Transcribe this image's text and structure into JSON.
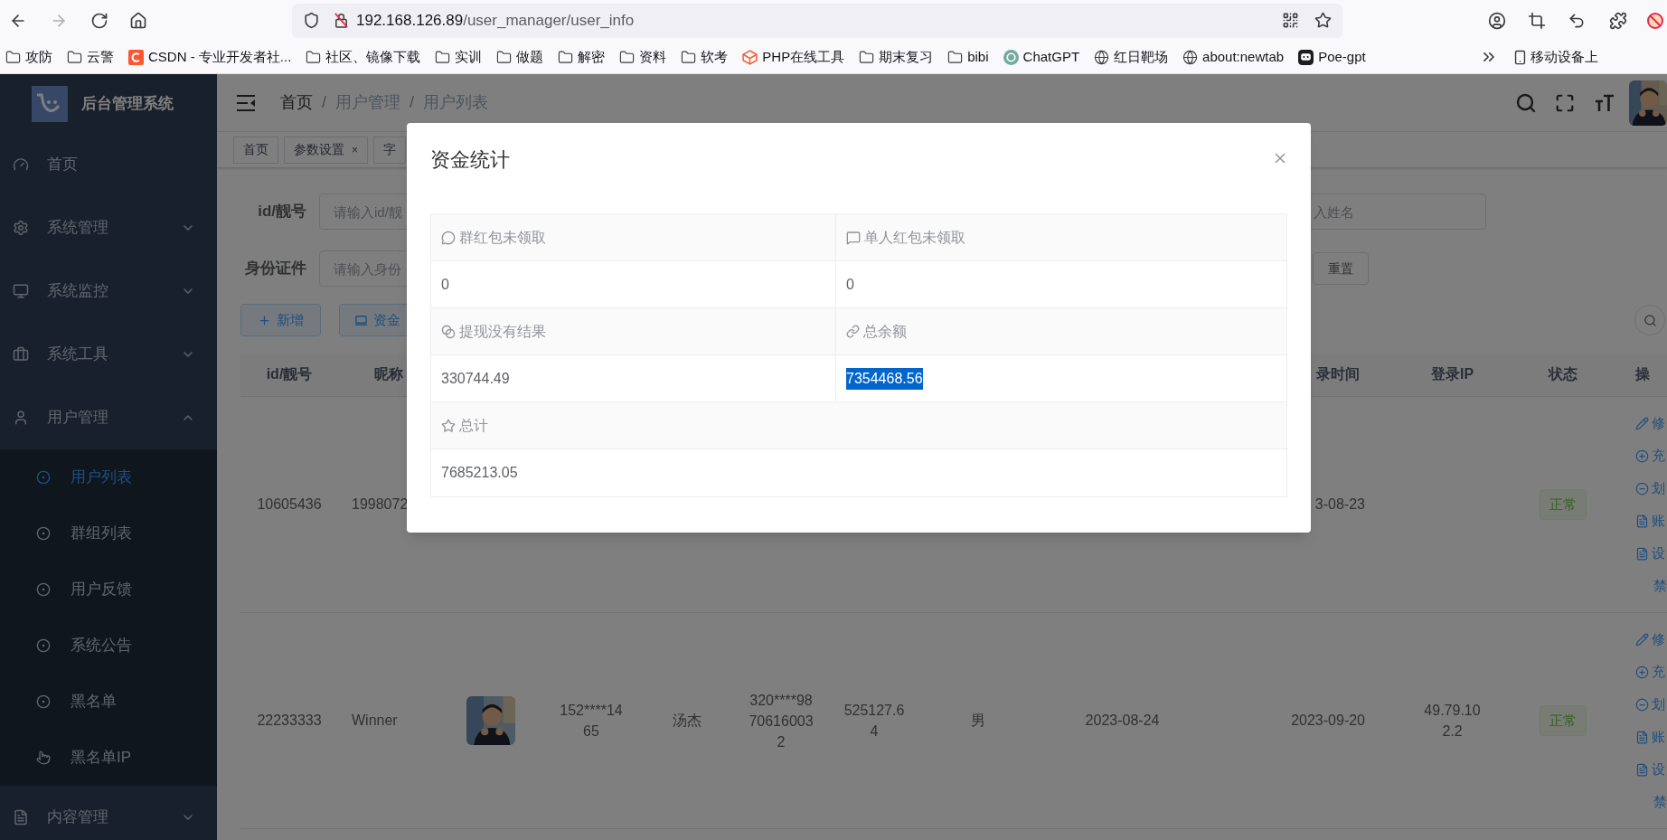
{
  "browser": {
    "url_host": "192.168.126.89",
    "url_path": "/user_manager/user_info",
    "bookmarks": [
      {
        "label": "攻防",
        "kind": "folder"
      },
      {
        "label": "云警",
        "kind": "folder"
      },
      {
        "label": "CSDN - 专业开发者社...",
        "kind": "csdn"
      },
      {
        "label": "社区、镜像下载",
        "kind": "folder"
      },
      {
        "label": "实训",
        "kind": "folder"
      },
      {
        "label": "做题",
        "kind": "folder"
      },
      {
        "label": "解密",
        "kind": "folder"
      },
      {
        "label": "资料",
        "kind": "folder"
      },
      {
        "label": "软考",
        "kind": "folder"
      },
      {
        "label": "PHP在线工具",
        "kind": "php"
      },
      {
        "label": "期末复习",
        "kind": "folder"
      },
      {
        "label": "bibi",
        "kind": "folder"
      },
      {
        "label": "ChatGPT",
        "kind": "chatgpt"
      },
      {
        "label": "红日靶场",
        "kind": "globe"
      },
      {
        "label": "about:newtab",
        "kind": "globe"
      },
      {
        "label": "Poe-gpt",
        "kind": "poe"
      }
    ],
    "mobile_bookmarks": "移动设备上"
  },
  "sidebar": {
    "title": "后台管理系统",
    "items": [
      {
        "label": "首页"
      },
      {
        "label": "系统管理",
        "expanded": false
      },
      {
        "label": "系统监控",
        "expanded": false
      },
      {
        "label": "系统工具",
        "expanded": false
      },
      {
        "label": "用户管理",
        "expanded": true,
        "children": [
          {
            "label": "用户列表",
            "selected": true
          },
          {
            "label": "群组列表",
            "selected": false
          },
          {
            "label": "用户反馈",
            "selected": false
          },
          {
            "label": "系统公告",
            "selected": false
          },
          {
            "label": "黑名单",
            "selected": false
          },
          {
            "label": "黑名单IP",
            "selected": false
          }
        ]
      },
      {
        "label": "内容管理",
        "expanded": false
      }
    ]
  },
  "header": {
    "breadcrumbs": [
      {
        "label": "首页",
        "link": true
      },
      {
        "label": "用户管理",
        "link": false
      },
      {
        "label": "用户列表",
        "link": false
      }
    ],
    "separators": [
      "/",
      "/"
    ]
  },
  "tags": [
    {
      "label": "首页"
    },
    {
      "label": "参数设置",
      "close_mark": "×"
    },
    {
      "label": "字"
    }
  ],
  "search_form": {
    "fields": [
      {
        "label": "id/靓号",
        "placeholder": "请输入id/靓"
      },
      {
        "placeholder": "入姓名"
      },
      {
        "label": "身份证件",
        "placeholder": "请输入身份"
      }
    ],
    "reset_button": "重置"
  },
  "toolbar": {
    "buttons": [
      {
        "label": "新增",
        "kind": "add"
      },
      {
        "label": "资金",
        "kind": "stats"
      }
    ]
  },
  "table": {
    "columns": [
      {
        "label": "id/靓号"
      },
      {
        "label": "昵称"
      },
      {
        "label": "录时间"
      },
      {
        "label": "登录IP"
      },
      {
        "label": "状态"
      },
      {
        "label": "操"
      }
    ],
    "rows": [
      {
        "id": "10605436",
        "nickname": "1998072",
        "last_login": "3-08-23",
        "status": {
          "label": "正常",
          "kind": "success"
        },
        "actions": [
          {
            "label": "修",
            "kind": "edit"
          },
          {
            "label": "充",
            "kind": "add"
          },
          {
            "label": "划",
            "kind": "subtract"
          },
          {
            "label": "账",
            "kind": "doc"
          },
          {
            "label": "设",
            "kind": "doc"
          },
          {
            "label": "禁",
            "kind": "plain"
          }
        ]
      },
      {
        "id": "22233333",
        "nickname": "Winner",
        "phone": "152****1465",
        "name": "汤杰",
        "id_card": "320****98706160032",
        "balance": "525127.64",
        "gender": "男",
        "created": "2023-08-24",
        "last_login": "2023-09-20",
        "login_ip": "49.79.102.2",
        "status": {
          "label": "正常",
          "kind": "success"
        },
        "actions": [
          {
            "label": "修",
            "kind": "edit"
          },
          {
            "label": "充",
            "kind": "add"
          },
          {
            "label": "划",
            "kind": "subtract"
          },
          {
            "label": "账",
            "kind": "doc"
          },
          {
            "label": "设",
            "kind": "doc"
          },
          {
            "label": "禁",
            "kind": "plain"
          }
        ]
      }
    ]
  },
  "modal": {
    "title": "资金统计",
    "stats": [
      {
        "label": "群红包未领取",
        "value": "0",
        "highlighted": false
      },
      {
        "label": "单人红包未领取",
        "value": "0",
        "highlighted": false
      },
      {
        "label": "提现没有结果",
        "value": "330744.49",
        "highlighted": false
      },
      {
        "label": "总余额",
        "value": "7354468.56",
        "highlighted": true
      },
      {
        "label": "总计",
        "value": "7685213.05",
        "highlighted": false,
        "kind": "wide"
      }
    ]
  }
}
